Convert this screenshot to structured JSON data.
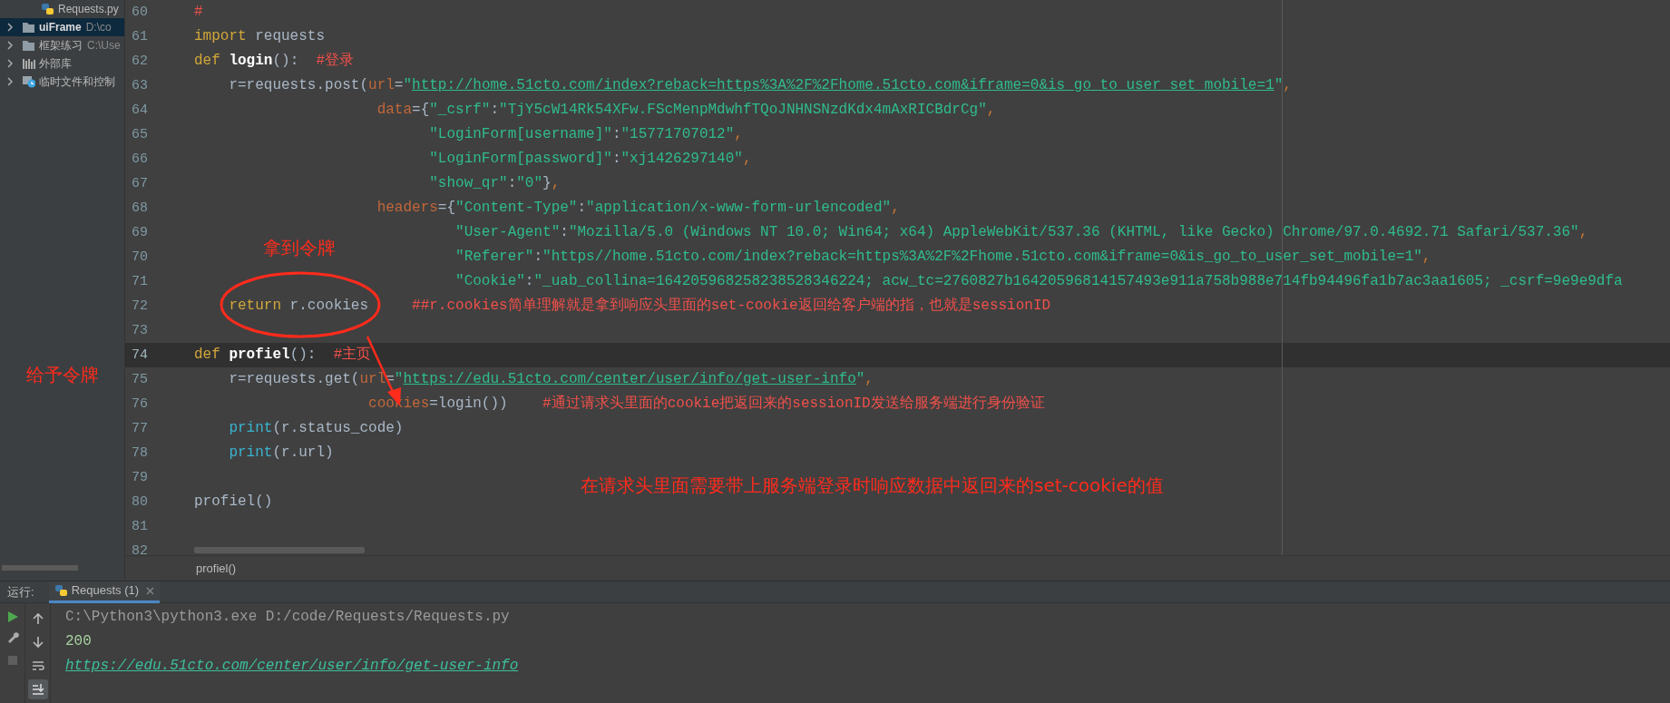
{
  "sidebar": {
    "items": [
      {
        "kind": "file",
        "label": "Requests.py",
        "selected": false
      },
      {
        "kind": "folder",
        "label": "uiFrame",
        "path": "D:\\co",
        "expanded": false,
        "selected": true
      },
      {
        "kind": "folder",
        "label": "框架练习",
        "path": "C:\\Use",
        "expanded": false,
        "selected": false
      },
      {
        "kind": "library",
        "label": "外部库",
        "expanded": false,
        "selected": false
      },
      {
        "kind": "scratch",
        "label": "临时文件和控制",
        "expanded": false,
        "selected": false
      }
    ]
  },
  "editor": {
    "lines": [
      {
        "number": "60",
        "current": false,
        "tokens": [
          {
            "kind": "comment",
            "text": "#"
          }
        ]
      },
      {
        "number": "61",
        "current": false,
        "tokens": [
          {
            "kind": "keyword",
            "text": "import"
          },
          {
            "kind": "plain",
            "text": " requests"
          }
        ]
      },
      {
        "number": "62",
        "current": false,
        "tokens": [
          {
            "kind": "keyword",
            "text": "def"
          },
          {
            "kind": "function",
            "text": " login"
          },
          {
            "kind": "plain",
            "text": "():  "
          },
          {
            "kind": "comment",
            "text": "#登录"
          }
        ]
      },
      {
        "number": "63",
        "current": false,
        "tokens": [
          {
            "kind": "plain",
            "text": "    r=requests.post("
          },
          {
            "kind": "param",
            "text": "url"
          },
          {
            "kind": "plain",
            "text": "="
          },
          {
            "kind": "string",
            "text": "\""
          },
          {
            "kind": "url",
            "text": "http://home.51cto.com/index?reback=https%3A%2F%2Fhome.51cto.com&iframe=0&is_go_to_user_set_mobile=1"
          },
          {
            "kind": "string",
            "text": "\""
          },
          {
            "kind": "punct",
            "text": ","
          }
        ]
      },
      {
        "number": "64",
        "current": false,
        "tokens": [
          {
            "kind": "param",
            "text": "                     data"
          },
          {
            "kind": "plain",
            "text": "={"
          },
          {
            "kind": "string",
            "text": "\"_csrf\""
          },
          {
            "kind": "plain",
            "text": ":"
          },
          {
            "kind": "string",
            "text": "\"TjY5cW14Rk54XFw.FScMenpMdwhfTQoJNHNSNzdKdx4mAxRICBdrCg\""
          },
          {
            "kind": "punct",
            "text": ","
          }
        ]
      },
      {
        "number": "65",
        "current": false,
        "tokens": [
          {
            "kind": "string",
            "text": "                           \"LoginForm[username]\""
          },
          {
            "kind": "plain",
            "text": ":"
          },
          {
            "kind": "string",
            "text": "\"15771707012\""
          },
          {
            "kind": "punct",
            "text": ","
          }
        ]
      },
      {
        "number": "66",
        "current": false,
        "tokens": [
          {
            "kind": "string",
            "text": "                           \"LoginForm[password]\""
          },
          {
            "kind": "plain",
            "text": ":"
          },
          {
            "kind": "string",
            "text": "\"xj1426297140\""
          },
          {
            "kind": "punct",
            "text": ","
          }
        ]
      },
      {
        "number": "67",
        "current": false,
        "tokens": [
          {
            "kind": "string",
            "text": "                           \"show_qr\""
          },
          {
            "kind": "plain",
            "text": ":"
          },
          {
            "kind": "string",
            "text": "\"0\""
          },
          {
            "kind": "plain",
            "text": "}"
          },
          {
            "kind": "punct",
            "text": ","
          }
        ]
      },
      {
        "number": "68",
        "current": false,
        "tokens": [
          {
            "kind": "param",
            "text": "                     headers"
          },
          {
            "kind": "plain",
            "text": "={"
          },
          {
            "kind": "string",
            "text": "\"Content-Type\""
          },
          {
            "kind": "plain",
            "text": ":"
          },
          {
            "kind": "string",
            "text": "\"application/x-www-form-urlencoded\""
          },
          {
            "kind": "punct",
            "text": ","
          }
        ]
      },
      {
        "number": "69",
        "current": false,
        "tokens": [
          {
            "kind": "string",
            "text": "                              \"User-Agent\""
          },
          {
            "kind": "plain",
            "text": ":"
          },
          {
            "kind": "string",
            "text": "\"Mozilla/5.0 (Windows NT 10.0; Win64; x64) AppleWebKit/537.36 (KHTML, like Gecko) Chrome/97.0.4692.71 Safari/537.36\""
          },
          {
            "kind": "punct",
            "text": ","
          }
        ]
      },
      {
        "number": "70",
        "current": false,
        "tokens": [
          {
            "kind": "string",
            "text": "                              \"Referer\""
          },
          {
            "kind": "plain",
            "text": ":"
          },
          {
            "kind": "string",
            "text": "\"https//home.51cto.com/index?reback=https%3A%2F%2Fhome.51cto.com&iframe=0&is_go_to_user_set_mobile=1\""
          },
          {
            "kind": "punct",
            "text": ","
          }
        ]
      },
      {
        "number": "71",
        "current": false,
        "tokens": [
          {
            "kind": "string",
            "text": "                              \"Cookie\""
          },
          {
            "kind": "plain",
            "text": ":"
          },
          {
            "kind": "string",
            "text": "\"_uab_collina=164205968258238528346224; acw_tc=2760827b16420596814157493e911a758b988e714fb94496fa1b7ac3aa1605; _csrf=9e9e9dfa"
          }
        ]
      },
      {
        "number": "72",
        "current": false,
        "tokens": [
          {
            "kind": "keyword",
            "text": "    return"
          },
          {
            "kind": "plain",
            "text": " r.cookies     "
          },
          {
            "kind": "comment",
            "text": "##r.cookies简单理解就是拿到响应头里面的set-cookie返回给客户端的指，也就是sessionID"
          }
        ]
      },
      {
        "number": "73",
        "current": false
      },
      {
        "number": "74",
        "current": true,
        "tokens": [
          {
            "kind": "keyword",
            "text": "def"
          },
          {
            "kind": "function",
            "text": " profiel"
          },
          {
            "kind": "plain",
            "text": "():  "
          },
          {
            "kind": "comment",
            "text": "#主页"
          }
        ]
      },
      {
        "number": "75",
        "current": false,
        "tokens": [
          {
            "kind": "plain",
            "text": "    r=requests.get("
          },
          {
            "kind": "param",
            "text": "url"
          },
          {
            "kind": "plain",
            "text": "="
          },
          {
            "kind": "string",
            "text": "\""
          },
          {
            "kind": "url",
            "text": "https://edu.51cto.com/center/user/info/get-user-info"
          },
          {
            "kind": "string",
            "text": "\""
          },
          {
            "kind": "punct",
            "text": ","
          }
        ]
      },
      {
        "number": "76",
        "current": false,
        "tokens": [
          {
            "kind": "param",
            "text": "                    cookies"
          },
          {
            "kind": "plain",
            "text": "=login())    "
          },
          {
            "kind": "comment",
            "text": "#通过请求头里面的cookie把返回来的sessionID发送给服务端进行身份验证"
          }
        ]
      },
      {
        "number": "77",
        "current": false,
        "tokens": [
          {
            "kind": "builtin",
            "text": "    print"
          },
          {
            "kind": "plain",
            "text": "(r.status_code)"
          }
        ]
      },
      {
        "number": "78",
        "current": false,
        "tokens": [
          {
            "kind": "builtin",
            "text": "    print"
          },
          {
            "kind": "plain",
            "text": "(r.url)"
          }
        ]
      },
      {
        "number": "79",
        "current": false
      },
      {
        "number": "80",
        "current": false,
        "tokens": [
          {
            "kind": "plain",
            "text": "profiel()"
          }
        ]
      },
      {
        "number": "81",
        "current": false
      },
      {
        "number": "82",
        "current": false
      }
    ],
    "breadcrumb": "profiel()"
  },
  "annotations": [
    {
      "text": "拿到令牌"
    },
    {
      "text": "给予令牌"
    },
    {
      "text": "在请求头里面需要带上服务端登录时响应数据中返回来的set-cookie的值"
    }
  ],
  "run_panel": {
    "label": "运行:",
    "tabs": [
      {
        "label": "Requests (1)",
        "selected": true
      }
    ],
    "tools": [
      {
        "kind": "up",
        "on": false
      },
      {
        "kind": "down",
        "on": false
      },
      {
        "kind": "wrap",
        "on": false
      },
      {
        "kind": "scroll_end",
        "on": true
      }
    ],
    "console": [
      {
        "kind": "command",
        "text": "C:\\Python3\\python3.exe D:/code/Requests/Requests.py"
      },
      {
        "kind": "output",
        "text": "200"
      },
      {
        "kind": "link",
        "text": "https://edu.51cto.com/center/user/info/get-user-info"
      }
    ]
  }
}
